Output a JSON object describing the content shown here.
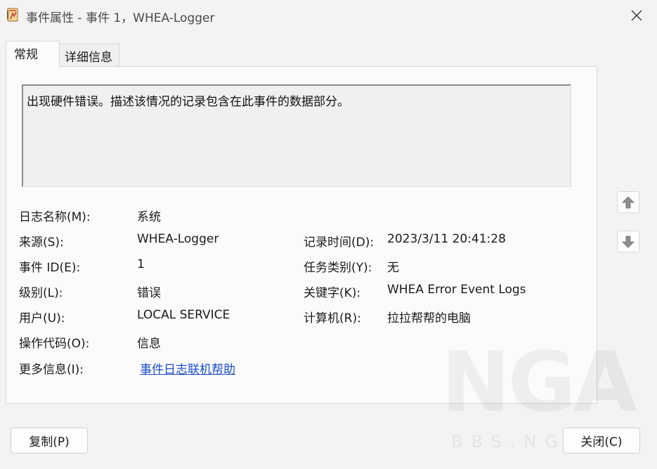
{
  "window": {
    "title": "事件属性 - 事件 1，WHEA-Logger",
    "app_icon": "event-viewer-icon",
    "close_icon": "close-icon"
  },
  "tabs": [
    {
      "label": "常规",
      "selected": true
    },
    {
      "label": "详细信息",
      "selected": false
    }
  ],
  "description": "出现硬件错误。描述该情况的记录包含在此事件的数据部分。",
  "fields": {
    "log_name": {
      "label": "日志名称(M):",
      "value": "系统"
    },
    "source": {
      "label": "来源(S):",
      "value": "WHEA-Logger"
    },
    "logged": {
      "label": "记录时间(D):",
      "value": "2023/3/11 20:41:28"
    },
    "event_id": {
      "label": "事件 ID(E):",
      "value": "1"
    },
    "task_category": {
      "label": "任务类别(Y):",
      "value": "无"
    },
    "level": {
      "label": "级别(L):",
      "value": "错误"
    },
    "keywords": {
      "label": "关键字(K):",
      "value": "WHEA Error Event Logs"
    },
    "user": {
      "label": "用户(U):",
      "value": "LOCAL SERVICE"
    },
    "computer": {
      "label": "计算机(R):",
      "value": "拉拉帮帮的电脑"
    },
    "opcode": {
      "label": "操作代码(O):",
      "value": "信息"
    },
    "more_info": {
      "label": "更多信息(I):",
      "link": "事件日志联机帮助"
    }
  },
  "nav": {
    "up_icon": "arrow-up-icon",
    "down_icon": "arrow-down-icon"
  },
  "buttons": {
    "copy": "复制(P)",
    "close": "关闭(C)"
  },
  "watermark": {
    "big": "NGA",
    "small": "BBS.NGA"
  },
  "colors": {
    "link": "#1a4ec7",
    "background": "#f3f3f3",
    "panel": "#fbfbfb"
  }
}
